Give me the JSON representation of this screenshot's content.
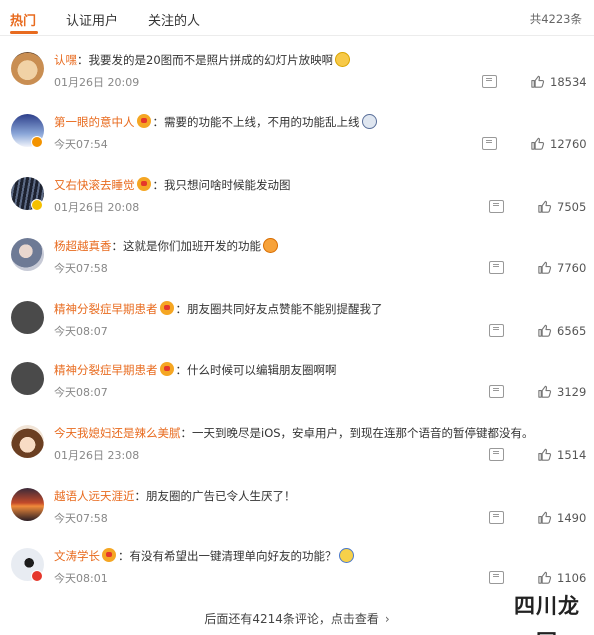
{
  "tabs": [
    {
      "label": "热门",
      "active": true
    },
    {
      "label": "认证用户",
      "active": false
    },
    {
      "label": "关注的人",
      "active": false
    }
  ],
  "total_count": "共4223条",
  "comments": [
    {
      "user": "认嘿",
      "text": "：我要发的是20图而不是照片拼成的幻灯片放映啊",
      "time": "01月26日 20:09",
      "likes": "18534",
      "avatar_icon": "shiba-dog-avatar",
      "emoji": "grin"
    },
    {
      "user": "第一眼的意中人",
      "text": "：需要的功能不上线，不用的功能乱上线",
      "time": "今天07:54",
      "likes": "12760",
      "avatar_icon": "blue-sky-avatar",
      "emoji": "crying"
    },
    {
      "user": "又右快滚去睡觉",
      "text": "：我只想问啥时候能发动图",
      "time": "01月26日 20:08",
      "likes": "7505",
      "avatar_icon": "dark-stripes-avatar"
    },
    {
      "user": "杨超越真香",
      "text": "：这就是你们加班开发的功能",
      "time": "今天07:58",
      "likes": "7760",
      "avatar_icon": "girl-photo-avatar",
      "emoji": "laughing"
    },
    {
      "user": "精神分裂症早期患者",
      "text": "：朋友圈共同好友点赞能不能别提醒我了",
      "time": "今天08:07",
      "likes": "6565",
      "avatar_icon": "default-gray-avatar"
    },
    {
      "user": "精神分裂症早期患者",
      "text": "：什么时候可以编辑朋友圈啊啊",
      "time": "今天08:07",
      "likes": "3129",
      "avatar_icon": "default-gray-avatar"
    },
    {
      "user": "今天我媳妇还是辣么美腻",
      "text": "：一天到晚尽是iOS，安卓用户，到现在连那个语音的暂停键都没有。",
      "time": "01月26日 23:08",
      "likes": "1514",
      "avatar_icon": "cartoon-girl-avatar"
    },
    {
      "user": "越语人远天涯近",
      "text": "：朋友圈的广告已令人生厌了！",
      "time": "今天07:58",
      "likes": "1490",
      "avatar_icon": "sunset-avatar"
    },
    {
      "user": "文涛学长",
      "text": "：有没有希望出一键清理单向好友的功能？",
      "time": "今天08:01",
      "likes": "1106",
      "avatar_icon": "skier-avatar",
      "emoji": "thinking"
    }
  ],
  "footer": {
    "text": "后面还有4214条评论，点击查看",
    "chevron": "›"
  },
  "watermark": "四川龙网",
  "colors": {
    "accent": "#e86b1f",
    "text": "#333333",
    "muted": "#888888"
  }
}
